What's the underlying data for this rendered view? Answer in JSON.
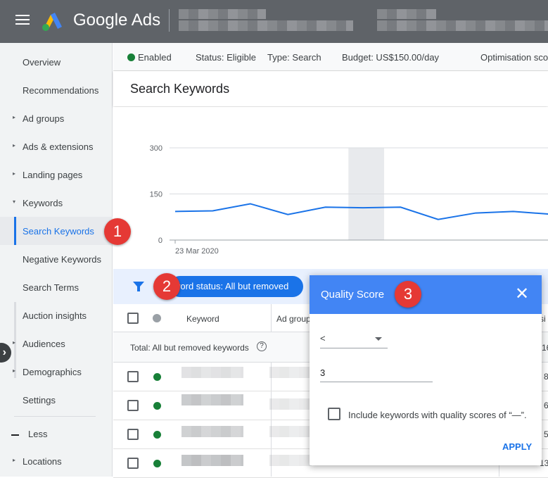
{
  "app": {
    "title": "Google Ads"
  },
  "sidebar": {
    "items": [
      {
        "label": "Overview",
        "caret": ""
      },
      {
        "label": "Recommendations",
        "caret": ""
      },
      {
        "label": "Ad groups",
        "caret": "▸"
      },
      {
        "label": "Ads & extensions",
        "caret": "▸"
      },
      {
        "label": "Landing pages",
        "caret": "▸"
      },
      {
        "label": "Keywords",
        "caret": "▾"
      },
      {
        "label": "Search Keywords",
        "caret": ""
      },
      {
        "label": "Negative Keywords",
        "caret": ""
      },
      {
        "label": "Search Terms",
        "caret": ""
      },
      {
        "label": "Auction insights",
        "caret": ""
      },
      {
        "label": "Audiences",
        "caret": "▸"
      },
      {
        "label": "Demographics",
        "caret": "▸"
      },
      {
        "label": "Settings",
        "caret": ""
      },
      {
        "label": "Locations",
        "caret": "▸"
      }
    ],
    "less_label": "Less"
  },
  "status": {
    "enabled": "Enabled",
    "status": "Status: Eligible",
    "type": "Type: Search",
    "budget": "Budget: US$150.00/day",
    "optimisation": "Optimisation sco"
  },
  "page": {
    "title": "Search Keywords"
  },
  "chart_data": {
    "type": "line",
    "x_start_label": "23 Mar 2020",
    "yticks": [
      "300",
      "150",
      "0"
    ],
    "ylim": [
      0,
      300
    ],
    "values": [
      93,
      95,
      118,
      83,
      107,
      105,
      107,
      67,
      88,
      93,
      84
    ],
    "highlight_index": 5,
    "color": "#1a73e8"
  },
  "filter": {
    "chip_label": "word status: All but removed"
  },
  "table": {
    "headers": {
      "keyword": "Keyword",
      "ad_group": "Ad group",
      "last": "si"
    },
    "total_label": "Total: All but removed keywords",
    "help_icon": "?",
    "right_values": [
      "16",
      "8",
      "6",
      "5",
      "13"
    ]
  },
  "dialog": {
    "title": "Quality Score",
    "close": "✕",
    "operator": "<",
    "value": "3",
    "include_label": "Include keywords with quality scores of “—”.",
    "apply": "APPLY"
  },
  "badges": [
    "1",
    "2",
    "3"
  ],
  "colors": {
    "accent": "#1a73e8",
    "header": "#5f6368",
    "badge": "#e53935",
    "dialog_head": "#4285f4"
  }
}
